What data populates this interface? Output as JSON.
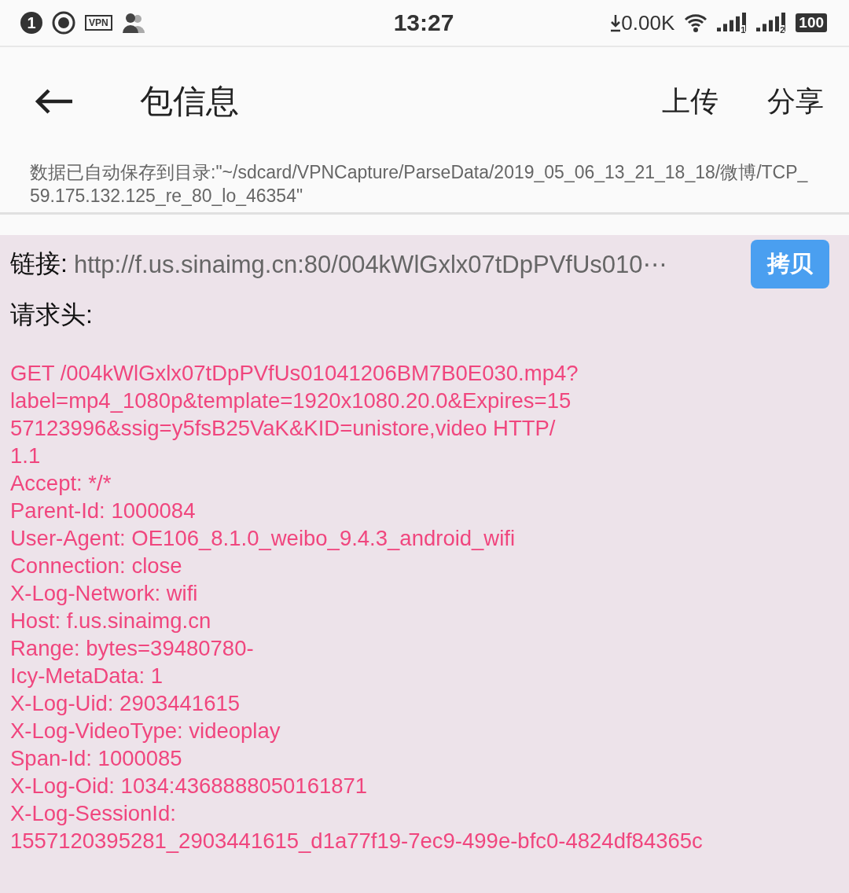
{
  "status_bar": {
    "notification_count": "1",
    "vpn_badge": "VPN",
    "time": "13:27",
    "net_speed": "0.00K",
    "sim_labels": [
      "1",
      "2"
    ],
    "battery": "100"
  },
  "toolbar": {
    "title": "包信息",
    "actions": [
      "上传",
      "分享"
    ]
  },
  "save_notice": "数据已自动保存到目录:\"~/sdcard/VPNCapture/ParseData/2019_05_06_13_21_18_18/微博/TCP_59.175.132.125_re_80_lo_46354\"",
  "link": {
    "label": "链接:",
    "url": "http://f.us.sinaimg.cn:80/004kWlGxlx07tDpPVfUs010⋯",
    "copy_button": "拷贝"
  },
  "headers_label": "请求头:",
  "request_lines": [
    "GET /004kWlGxlx07tDpPVfUs01041206BM7B0E030.mp4?",
    "label=mp4_1080p&template=1920x1080.20.0&Expires=15",
    "57123996&ssig=y5fsB25VaK&KID=unistore,video HTTP/",
    "1.1",
    "Accept: */*",
    "Parent-Id: 1000084",
    "User-Agent: OE106_8.1.0_weibo_9.4.3_android_wifi",
    "Connection: close",
    "X-Log-Network: wifi",
    "Host: f.us.sinaimg.cn",
    "Range: bytes=39480780-",
    "Icy-MetaData: 1",
    "X-Log-Uid: 2903441615",
    "X-Log-VideoType: videoplay",
    "Span-Id: 1000085",
    "X-Log-Oid: 1034:4368888050161871",
    "X-Log-SessionId:",
    "1557120395281_2903441615_d1a77f19-7ec9-499e-bfc0-4824df84365c"
  ]
}
